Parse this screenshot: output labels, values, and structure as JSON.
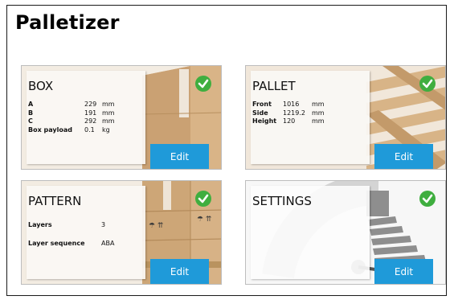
{
  "app": {
    "title": "Palletizer"
  },
  "colors": {
    "check": "#3fae3f",
    "edit_button": "#1f9ad9",
    "card_panel": "#faf8f4"
  },
  "cards": {
    "box": {
      "title": "BOX",
      "status_icon": "check-circle-icon",
      "edit_label": "Edit",
      "props": [
        {
          "label": "A",
          "value": "229",
          "unit": "mm"
        },
        {
          "label": "B",
          "value": "191",
          "unit": "mm"
        },
        {
          "label": "C",
          "value": "292",
          "unit": "mm"
        },
        {
          "label": "Box payload",
          "value": "0.1",
          "unit": "kg"
        }
      ]
    },
    "pallet": {
      "title": "PALLET",
      "status_icon": "check-circle-icon",
      "edit_label": "Edit",
      "props": [
        {
          "label": "Front",
          "value": "1016",
          "unit": "mm"
        },
        {
          "label": "Side",
          "value": "1219.2",
          "unit": "mm"
        },
        {
          "label": "Height",
          "value": "120",
          "unit": "mm"
        }
      ]
    },
    "pattern": {
      "title": "PATTERN",
      "status_icon": "check-circle-icon",
      "edit_label": "Edit",
      "props": [
        {
          "label": "Layers",
          "value": "3",
          "unit": ""
        },
        {
          "label": "Layer sequence",
          "value": "ABA",
          "unit": ""
        }
      ]
    },
    "settings": {
      "title": "SETTINGS",
      "status_icon": "check-circle-icon",
      "edit_label": "Edit"
    }
  }
}
